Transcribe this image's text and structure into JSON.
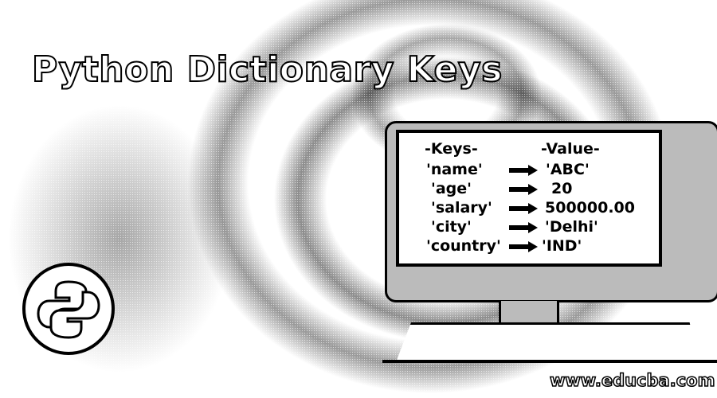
{
  "title": "Python Dictionary Keys",
  "table": {
    "keys_header": "-Keys-",
    "value_header": "-Value-",
    "rows": [
      {
        "key": "'name'",
        "value": "'ABC'"
      },
      {
        "key": "'age'",
        "value": "20"
      },
      {
        "key": "'salary'",
        "value": "500000.00"
      },
      {
        "key": "'city'",
        "value": "'Delhi'"
      },
      {
        "key": "'country'",
        "value": "'IND'"
      }
    ]
  },
  "logo_icon": "python-logo-icon",
  "website": "www.educba.com"
}
